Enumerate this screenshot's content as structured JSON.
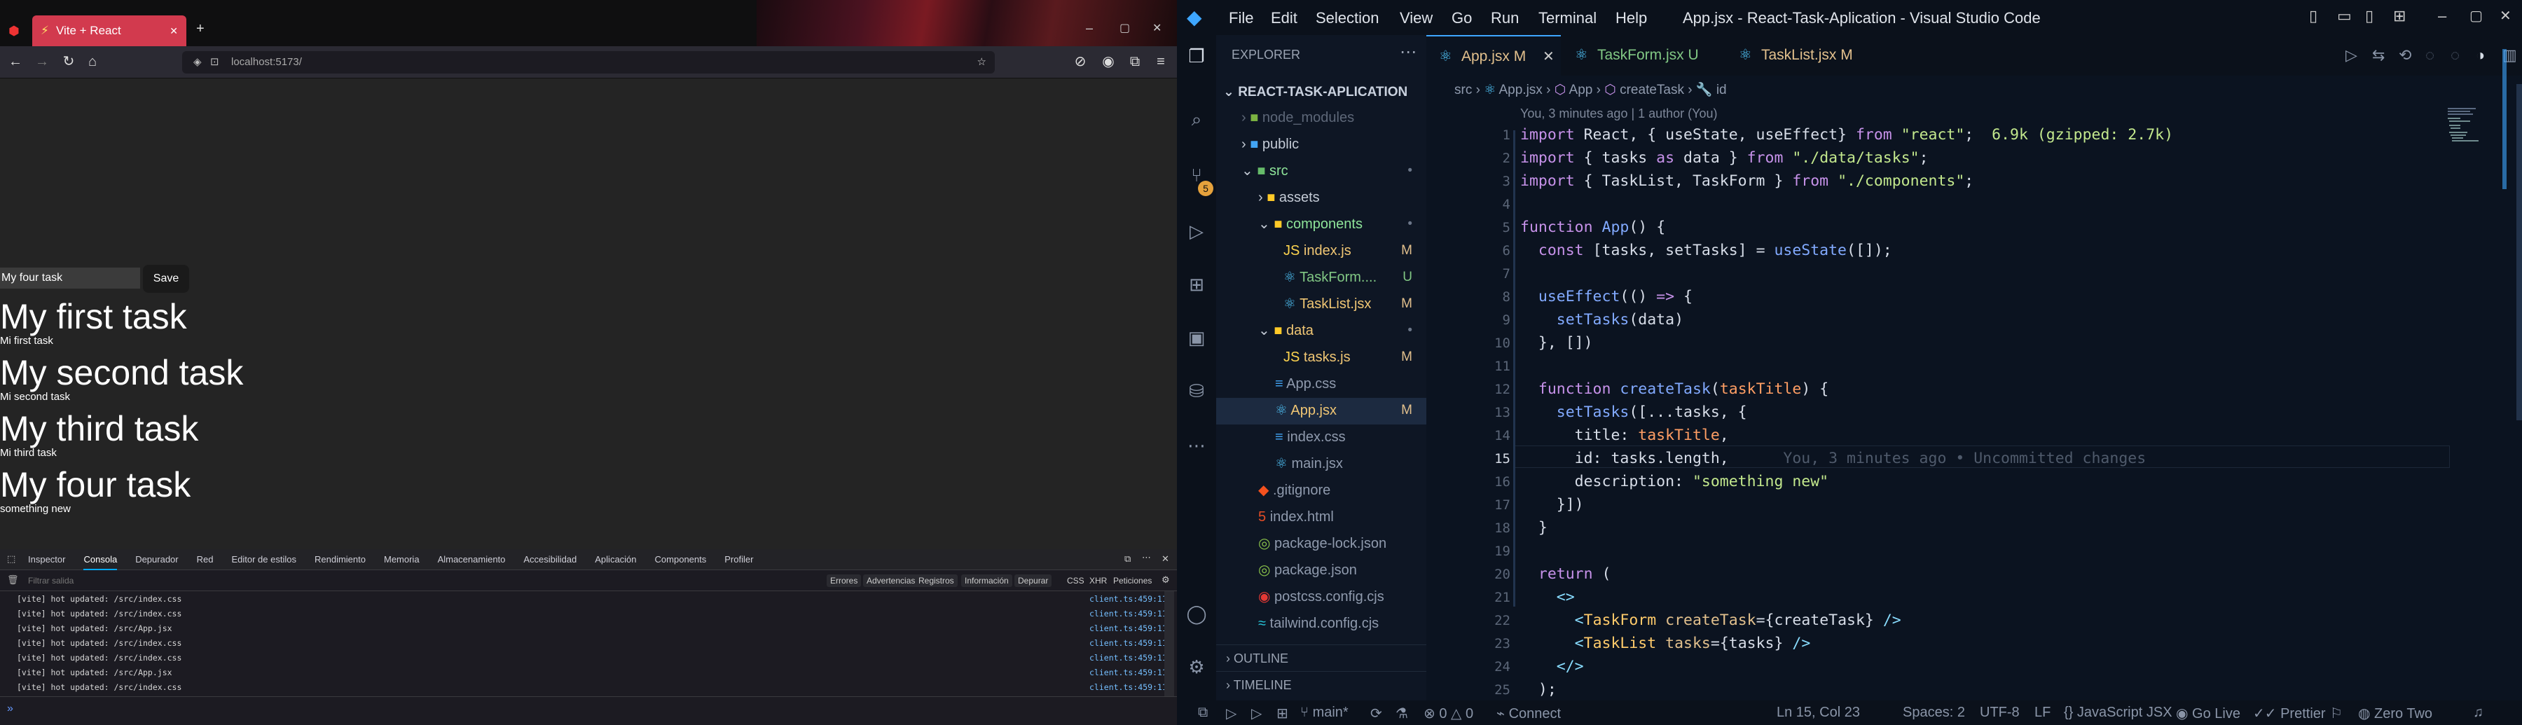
{
  "browser": {
    "tab_title": "Vite + React",
    "url": "localhost:5173/",
    "app": {
      "input_value": "My four task",
      "save_label": "Save",
      "tasks": [
        {
          "title": "My first task",
          "description": "Mi first task"
        },
        {
          "title": "My second task",
          "description": "Mi second task"
        },
        {
          "title": "My third task",
          "description": "Mi third task"
        },
        {
          "title": "My four task",
          "description": "something new"
        }
      ]
    },
    "devtools": {
      "tabs": [
        "Inspector",
        "Consola",
        "Depurador",
        "Red",
        "Editor de estilos",
        "Rendimiento",
        "Memoria",
        "Almacenamiento",
        "Accesibilidad",
        "Aplicación",
        "Components",
        "Profiler"
      ],
      "active_tab": "Consola",
      "filter_placeholder": "Filtrar salida",
      "filters": [
        "Errores",
        "Advertencias",
        "Registros",
        "Información",
        "Depurar"
      ],
      "right_filters": [
        "CSS",
        "XHR",
        "Peticiones"
      ],
      "logs": [
        {
          "text": "[vite] hot updated: /src/index.css",
          "loc": "client.ts:459:11"
        },
        {
          "text": "[vite] hot updated: /src/index.css",
          "loc": "client.ts:459:11"
        },
        {
          "text": "[vite] hot updated: /src/App.jsx",
          "loc": "client.ts:459:11"
        },
        {
          "text": "[vite] hot updated: /src/index.css",
          "loc": "client.ts:459:11"
        },
        {
          "text": "[vite] hot updated: /src/index.css",
          "loc": "client.ts:459:11"
        },
        {
          "text": "[vite] hot updated: /src/App.jsx",
          "loc": "client.ts:459:11"
        },
        {
          "text": "[vite] hot updated: /src/index.css",
          "loc": "client.ts:459:11"
        }
      ],
      "prompt": "»"
    }
  },
  "vscode": {
    "window_title": "App.jsx - React-Task-Aplication - Visual Studio Code",
    "menu": [
      "File",
      "Edit",
      "Selection",
      "View",
      "Go",
      "Run",
      "Terminal",
      "Help"
    ],
    "explorer": {
      "header": "EXPLORER",
      "project": "REACT-TASK-APLICATION",
      "items": [
        {
          "label": "node_modules",
          "badge": ""
        },
        {
          "label": "public",
          "badge": ""
        },
        {
          "label": "src",
          "badge": "•"
        },
        {
          "label": "assets",
          "badge": ""
        },
        {
          "label": "components",
          "badge": "•"
        },
        {
          "label": "index.js",
          "badge": "M"
        },
        {
          "label": "TaskForm....",
          "badge": "U"
        },
        {
          "label": "TaskList.jsx",
          "badge": "M"
        },
        {
          "label": "data",
          "badge": "•"
        },
        {
          "label": "tasks.js",
          "badge": "M"
        },
        {
          "label": "App.css",
          "badge": ""
        },
        {
          "label": "App.jsx",
          "badge": "M"
        },
        {
          "label": "index.css",
          "badge": ""
        },
        {
          "label": "main.jsx",
          "badge": ""
        },
        {
          "label": ".gitignore",
          "badge": ""
        },
        {
          "label": "index.html",
          "badge": ""
        },
        {
          "label": "package-lock.json",
          "badge": ""
        },
        {
          "label": "package.json",
          "badge": ""
        },
        {
          "label": "postcss.config.cjs",
          "badge": ""
        },
        {
          "label": "tailwind.config.cjs",
          "badge": ""
        }
      ],
      "outline": "OUTLINE",
      "timeline": "TIMELINE"
    },
    "tabs": [
      {
        "label": "App.jsx",
        "mark": "M"
      },
      {
        "label": "TaskForm.jsx",
        "mark": "U"
      },
      {
        "label": "TaskList.jsx",
        "mark": "M"
      }
    ],
    "breadcrumb": [
      "src",
      "App.jsx",
      "App",
      "createTask",
      "id"
    ],
    "blame": "You, 3 minutes ago | 1 author (You)",
    "import_size": "6.9k (gzipped: 2.7k)",
    "inline_blame": "You, 3 minutes ago • Uncommitted changes",
    "source_control_badge": "5",
    "status": {
      "branch": "main*",
      "errors": "0",
      "warnings": "0",
      "connect": "Connect",
      "position": "Ln 15, Col 23",
      "spaces": "Spaces: 2",
      "encoding": "UTF-8",
      "eol": "LF",
      "language": "JavaScript JSX",
      "golive": "Go Live",
      "prettier": "Prettier",
      "theme": "Zero Two"
    }
  }
}
